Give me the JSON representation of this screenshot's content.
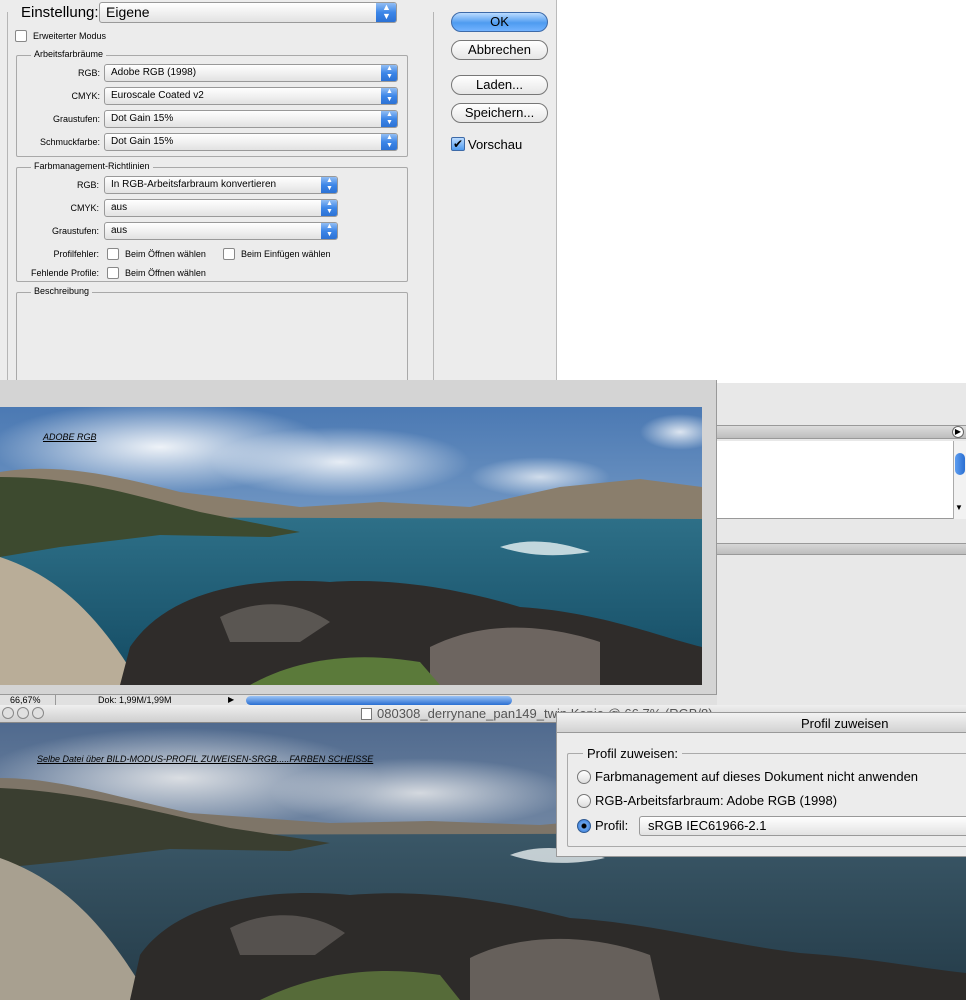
{
  "color_settings": {
    "einstellung_label": "Einstellung:",
    "einstellung_value": "Eigene",
    "erweiterter_modus": "Erweiterter Modus",
    "arbeitsfarbraeume": {
      "title": "Arbeitsfarbräume",
      "rows": [
        {
          "label": "RGB:",
          "value": "Adobe RGB (1998)"
        },
        {
          "label": "CMYK:",
          "value": "Euroscale Coated v2"
        },
        {
          "label": "Graustufen:",
          "value": "Dot Gain 15%"
        },
        {
          "label": "Schmuckfarbe:",
          "value": "Dot Gain 15%"
        }
      ]
    },
    "richtlinien": {
      "title": "Farbmanagement-Richtlinien",
      "rows": [
        {
          "label": "RGB:",
          "value": "In RGB-Arbeitsfarbraum konvertieren"
        },
        {
          "label": "CMYK:",
          "value": "aus"
        },
        {
          "label": "Graustufen:",
          "value": "aus"
        }
      ],
      "profilfehler_label": "Profilfehler:",
      "profilfehler_oeffnen": "Beim Öffnen wählen",
      "profilfehler_einfuegen": "Beim Einfügen wählen",
      "fehlende_label": "Fehlende Profile:",
      "fehlende_oeffnen": "Beim Öffnen wählen"
    },
    "beschreibung": "Beschreibung",
    "buttons": {
      "ok": "OK",
      "abbrechen": "Abbrechen",
      "laden": "Laden...",
      "speichern": "Speichern..."
    },
    "vorschau": "Vorschau",
    "vorschau_checked": true
  },
  "upper_window": {
    "overlay_text": "ADOBE RGB",
    "zoom": "66,67%",
    "dok": "Dok: 1,99M/1,99M"
  },
  "lower_window": {
    "title": "080308_derrynane_pan149_twin Kopie @ 66,7% (RGB/8)",
    "overlay_text": "Selbe Datei über BILD-MODUS-PROFIL ZUWEISEN-SRGB.....FARBEN SCHEISSE"
  },
  "assign_profile": {
    "title": "Profil zuweisen",
    "group_label": "Profil zuweisen:",
    "options": [
      {
        "label": "Farbmanagement auf dieses Dokument nicht anwenden",
        "selected": false
      },
      {
        "label": "RGB-Arbeitsfarbraum: Adobe RGB (1998)",
        "selected": false
      },
      {
        "label": "Profil:",
        "selected": true
      }
    ],
    "profile_value": "sRGB IEC61966-2.1"
  },
  "colors": {
    "accent": "#3c86e8",
    "dialog_bg": "#ececec"
  }
}
